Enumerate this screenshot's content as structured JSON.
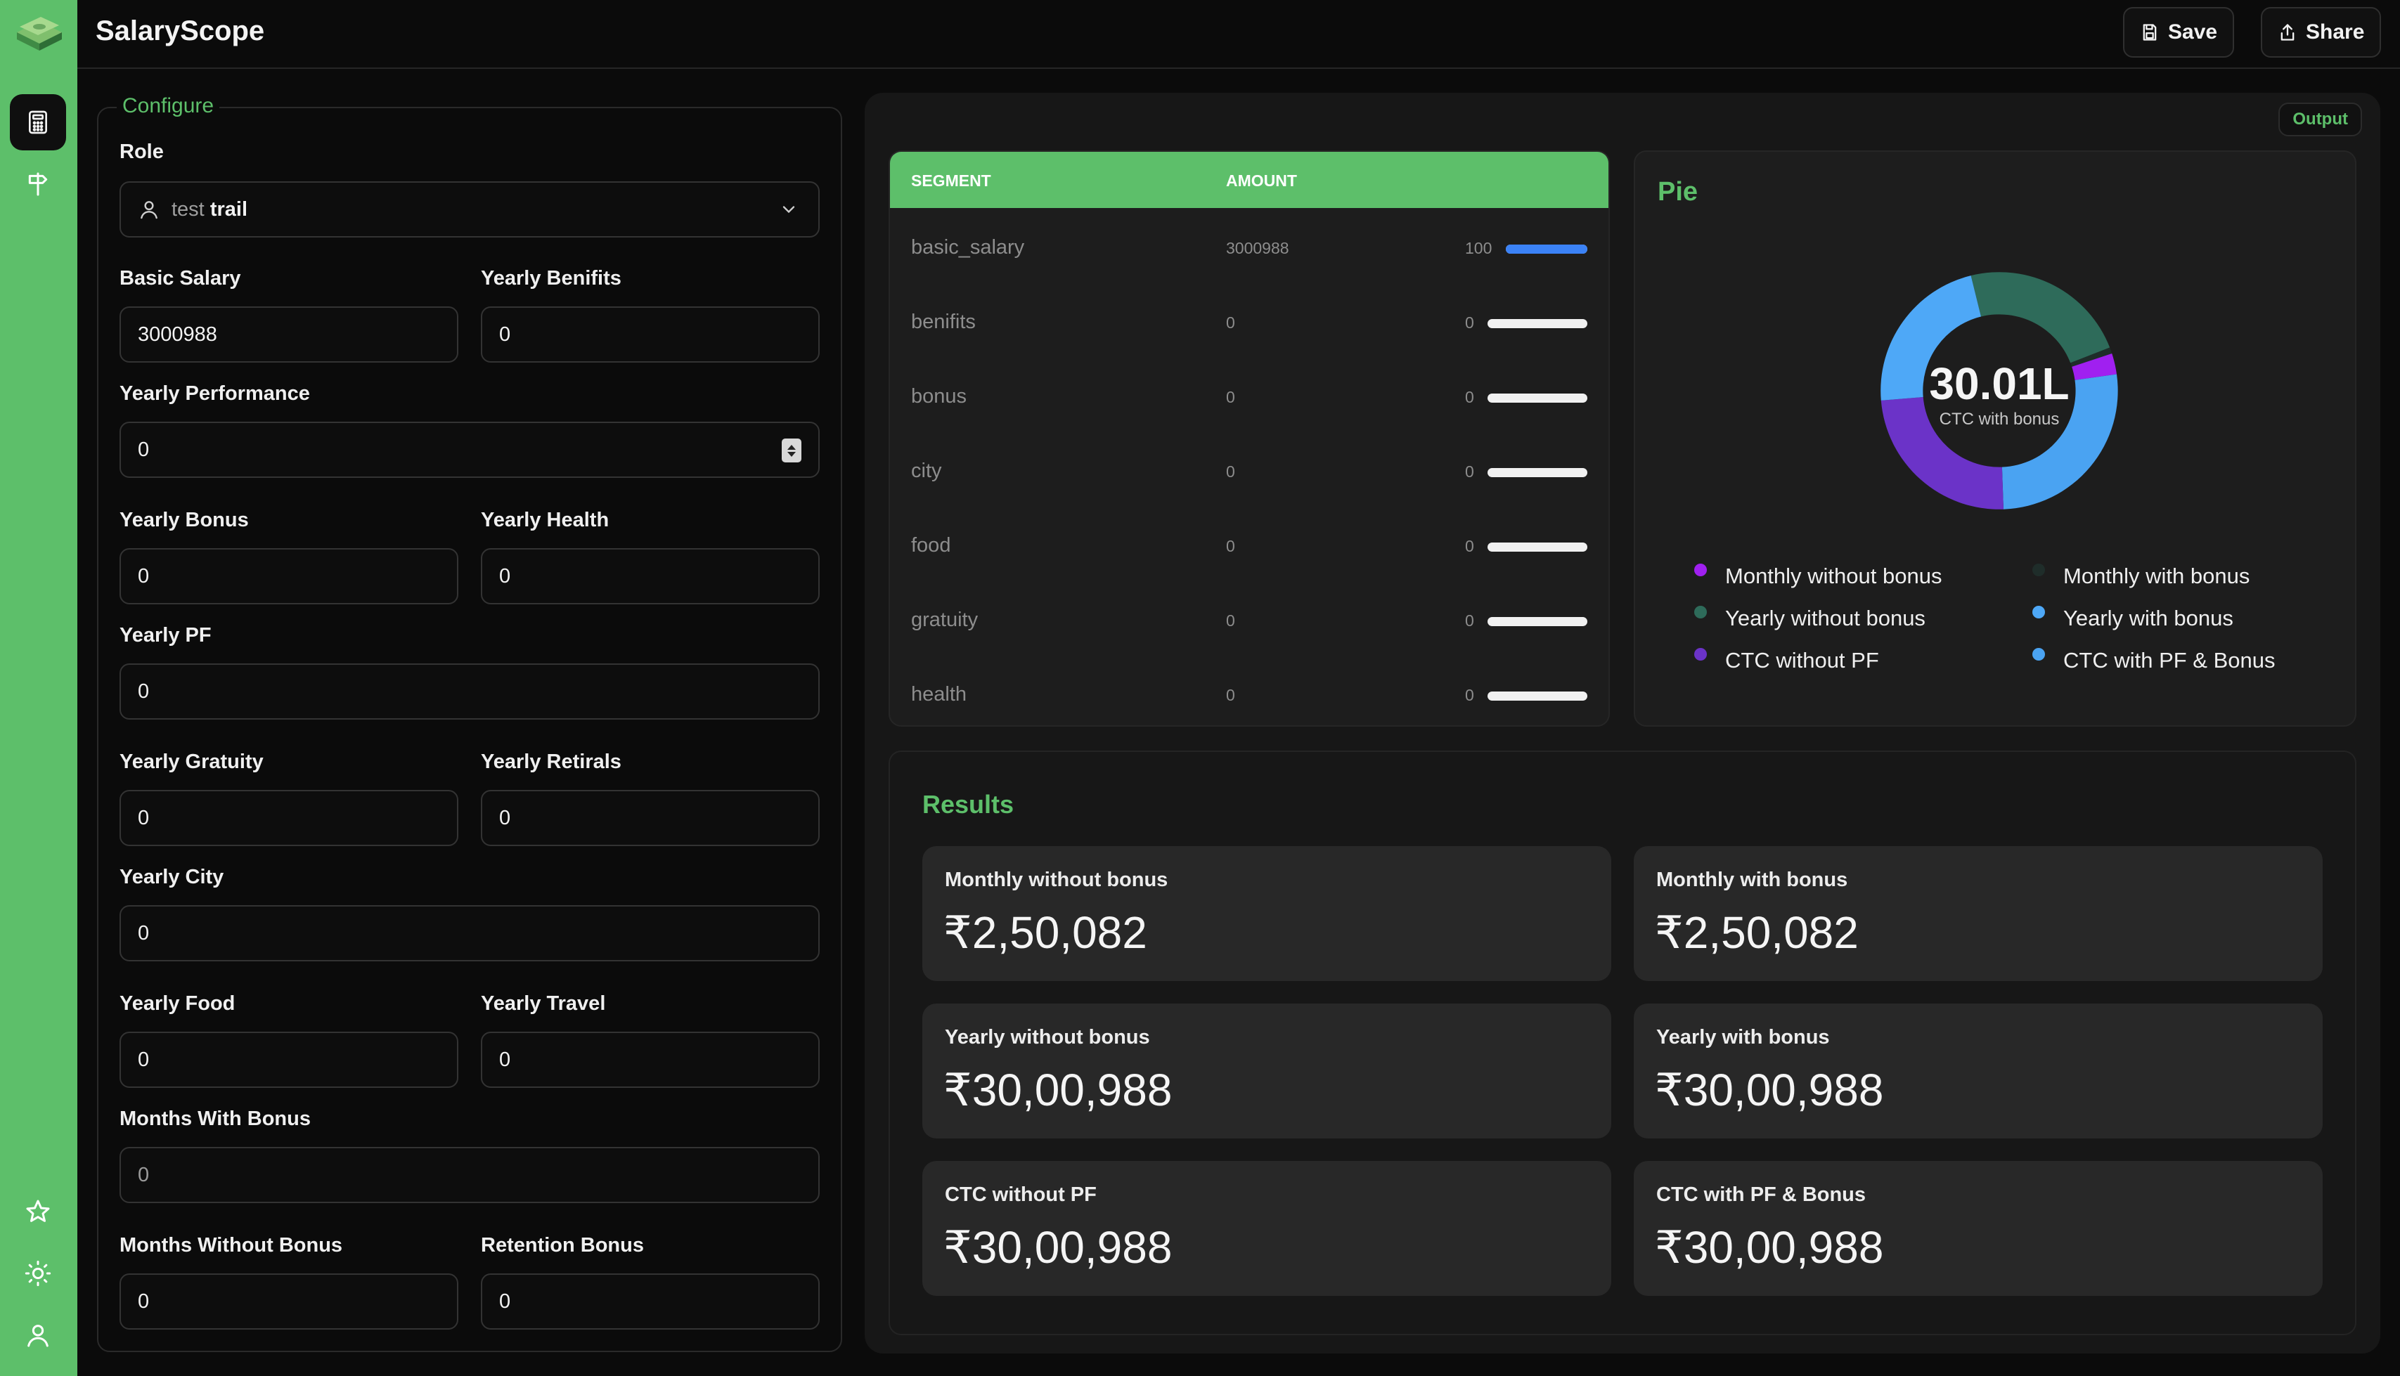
{
  "app": {
    "title": "SalaryScope"
  },
  "toolbar": {
    "save_label": "Save",
    "share_label": "Share"
  },
  "rail": {
    "top_icons": [
      "calculator-icon",
      "signpost-icon"
    ],
    "bottom_icons": [
      "star-icon",
      "sun-icon",
      "user-icon"
    ]
  },
  "configure": {
    "legend": "Configure",
    "role": {
      "label": "Role",
      "prefix": "test",
      "name": "trail"
    },
    "fields": {
      "basic_salary": {
        "label": "Basic Salary",
        "value": "3000988"
      },
      "yearly_benifits": {
        "label": "Yearly Benifits",
        "value": "0"
      },
      "yearly_performance": {
        "label": "Yearly Performance",
        "value": "0"
      },
      "yearly_bonus": {
        "label": "Yearly Bonus",
        "value": "0"
      },
      "yearly_health": {
        "label": "Yearly Health",
        "value": "0"
      },
      "yearly_pf": {
        "label": "Yearly PF",
        "value": "0"
      },
      "yearly_gratuity": {
        "label": "Yearly Gratuity",
        "value": "0"
      },
      "yearly_retirals": {
        "label": "Yearly Retirals",
        "value": "0"
      },
      "yearly_city": {
        "label": "Yearly City",
        "value": "0"
      },
      "yearly_food": {
        "label": "Yearly Food",
        "value": "0"
      },
      "yearly_travel": {
        "label": "Yearly Travel",
        "value": "0"
      },
      "months_with_bonus": {
        "label": "Months With Bonus",
        "value": "0"
      },
      "months_without_bonus": {
        "label": "Months Without Bonus",
        "value": "0"
      },
      "retention_bonus": {
        "label": "Retention Bonus",
        "value": "0"
      }
    }
  },
  "output": {
    "badge": "Output",
    "segments": {
      "col_segment": "SEGMENT",
      "col_amount": "AMOUNT",
      "rows": [
        {
          "name": "basic_salary",
          "amount": "3000988",
          "percent": "100",
          "fill": 1.0
        },
        {
          "name": "benifits",
          "amount": "0",
          "percent": "0",
          "fill": 0
        },
        {
          "name": "bonus",
          "amount": "0",
          "percent": "0",
          "fill": 0
        },
        {
          "name": "city",
          "amount": "0",
          "percent": "0",
          "fill": 0
        },
        {
          "name": "food",
          "amount": "0",
          "percent": "0",
          "fill": 0
        },
        {
          "name": "gratuity",
          "amount": "0",
          "percent": "0",
          "fill": 0
        },
        {
          "name": "health",
          "amount": "0",
          "percent": "0",
          "fill": 0
        }
      ]
    },
    "pie": {
      "title": "Pie",
      "center_value": "30.01L",
      "center_caption": "CTC with bonus",
      "legend": [
        {
          "label": "Monthly without bonus",
          "color": "#a020f0"
        },
        {
          "label": "Monthly with bonus",
          "color": "#1f2d2a"
        },
        {
          "label": "Yearly without bonus",
          "color": "#2e6b5a"
        },
        {
          "label": "Yearly with bonus",
          "color": "#4ea8f7"
        },
        {
          "label": "CTC without PF",
          "color": "#6b33c8"
        },
        {
          "label": "CTC with PF & Bonus",
          "color": "#4aa3f2"
        }
      ]
    },
    "results": {
      "title": "Results",
      "items": [
        {
          "label": "Monthly without bonus",
          "value": "₹2,50,082"
        },
        {
          "label": "Monthly with bonus",
          "value": "₹2,50,082"
        },
        {
          "label": "Yearly without bonus",
          "value": "₹30,00,988"
        },
        {
          "label": "Yearly with bonus",
          "value": "₹30,00,988"
        },
        {
          "label": "CTC without PF",
          "value": "₹30,00,988"
        },
        {
          "label": "CTC with PF & Bonus",
          "value": "₹30,00,988"
        }
      ]
    }
  },
  "colors": {
    "accent": "#5dbf6a",
    "bar_fill": "#3b82f6",
    "pie_teal": "#2e6b5a",
    "pie_blue": "#4ea8f7",
    "pie_purple": "#6b33c8",
    "pie_violet": "#a020f0"
  }
}
